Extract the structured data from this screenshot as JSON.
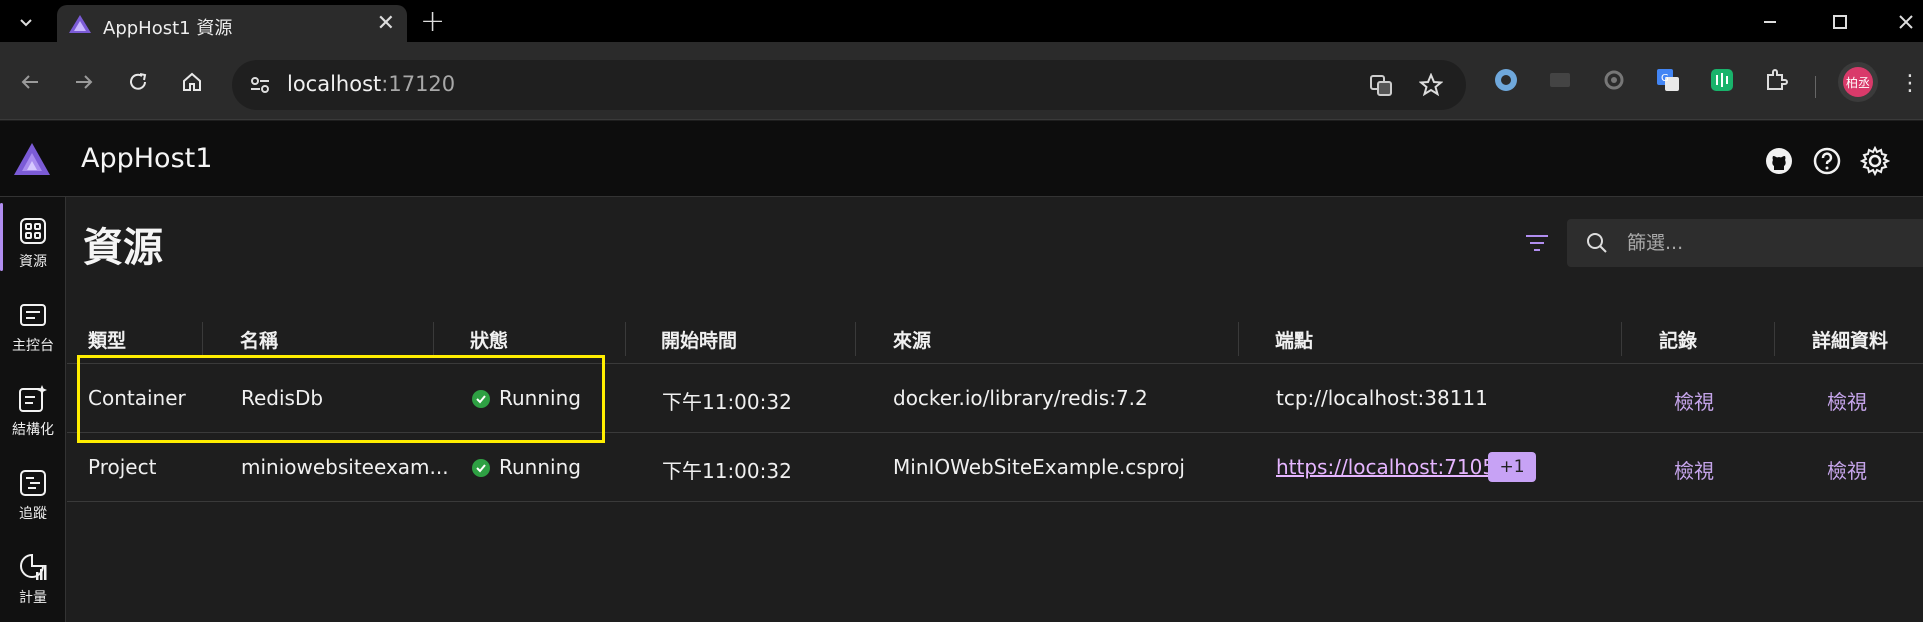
{
  "browser": {
    "tab_title": "AppHost1 資源",
    "url_host": "localhost",
    "url_port": ":17120",
    "profile_initials": "柏丞",
    "extensions": [
      "bitwarden-icon",
      "film-icon",
      "sync-icon",
      "translate-icon",
      "chart-bars-icon",
      "puzzle-icon"
    ]
  },
  "app": {
    "title": "AppHost1"
  },
  "nav": {
    "items": [
      {
        "label": "資源",
        "icon": "resources-icon"
      },
      {
        "label": "主控台",
        "icon": "console-icon"
      },
      {
        "label": "結構化",
        "icon": "structured-logs-icon"
      },
      {
        "label": "追蹤",
        "icon": "traces-icon"
      },
      {
        "label": "計量",
        "icon": "metrics-icon"
      }
    ]
  },
  "page": {
    "title": "資源",
    "search_placeholder": "篩選..."
  },
  "table": {
    "columns": [
      "類型",
      "名稱",
      "狀態",
      "開始時間",
      "來源",
      "端點",
      "記錄",
      "詳細資料"
    ],
    "rows": [
      {
        "type": "Container",
        "name": "RedisDb",
        "state": "Running",
        "start_time": "下午11:00:32",
        "source": "docker.io/library/redis:7.2",
        "endpoint": "tcp://localhost:38111",
        "endpoint_is_link": false,
        "extra_endpoints": "",
        "logs": "檢視",
        "details": "檢視"
      },
      {
        "type": "Project",
        "name": "miniowebsiteexam...",
        "state": "Running",
        "start_time": "下午11:00:32",
        "source": "MinIOWebSiteExample.csproj",
        "endpoint": "https://localhost:7105",
        "endpoint_suffix": ",",
        "endpoint_is_link": true,
        "extra_endpoints": "+1",
        "logs": "檢視",
        "details": "檢視"
      }
    ]
  },
  "colors": {
    "accent": "#b18ef0",
    "running": "#2ea043",
    "highlight": "#ffee00",
    "link": "#c5a4ea"
  }
}
